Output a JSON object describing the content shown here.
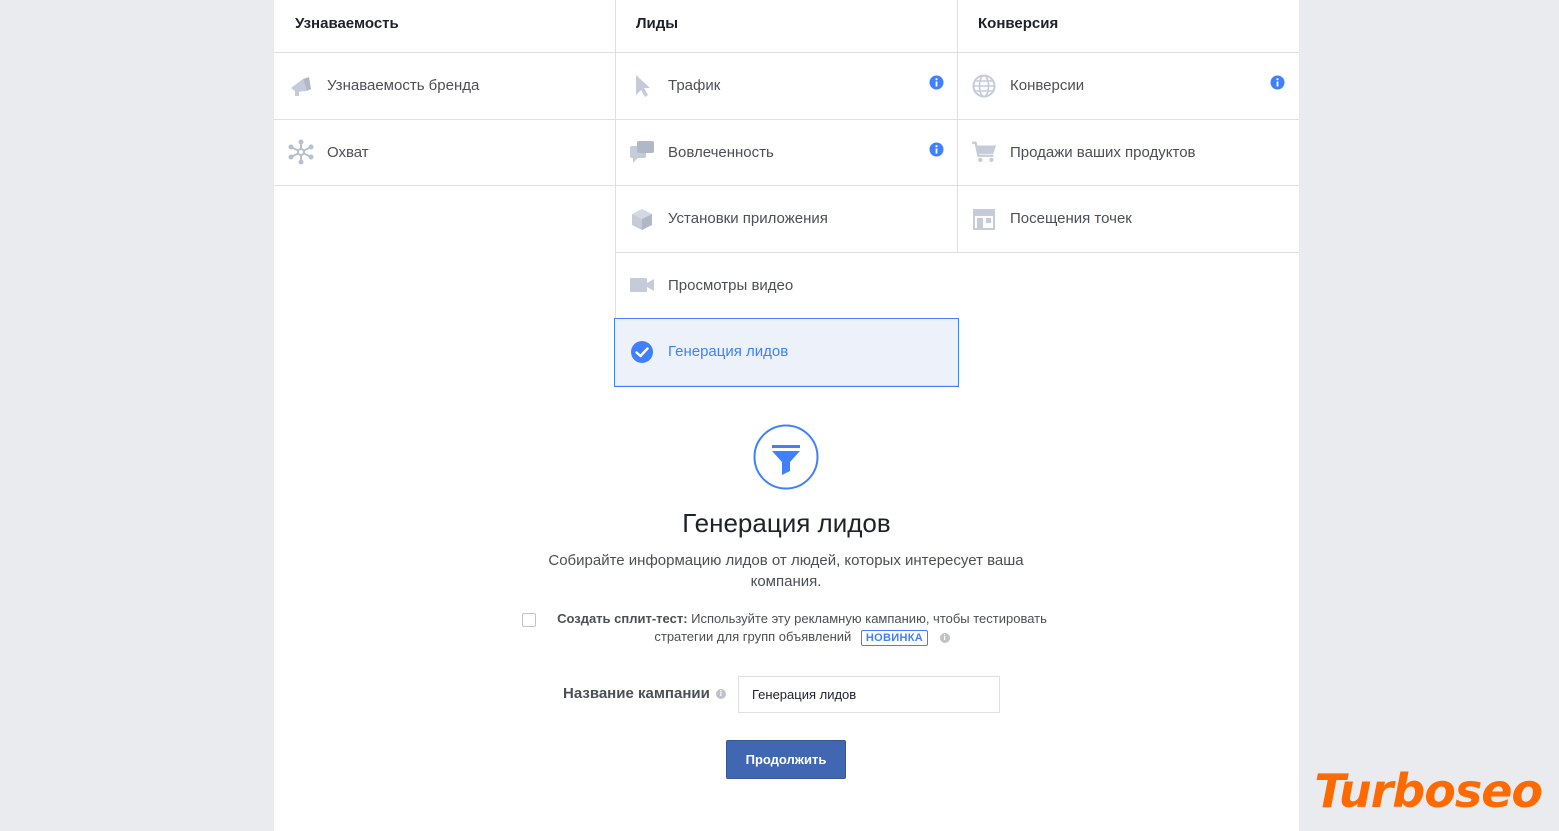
{
  "colors": {
    "accent": "#4080ff",
    "button": "#4267b2",
    "selected_bg": "#edf2fa",
    "watermark": "#ff6a00"
  },
  "columns": [
    {
      "title": "Узнаваемость",
      "items": [
        {
          "label": "Узнаваемость бренда",
          "icon": "megaphone-icon",
          "info": false
        },
        {
          "label": "Охват",
          "icon": "reach-icon",
          "info": false
        }
      ]
    },
    {
      "title": "Лиды",
      "items": [
        {
          "label": "Трафик",
          "icon": "cursor-icon",
          "info": true
        },
        {
          "label": "Вовлеченность",
          "icon": "chat-bubbles-icon",
          "info": true
        },
        {
          "label": "Установки приложения",
          "icon": "box-icon",
          "info": false
        },
        {
          "label": "Просмотры видео",
          "icon": "video-camera-icon",
          "info": false
        },
        {
          "label": "Генерация лидов",
          "icon": "check-circle-icon",
          "info": false,
          "selected": true
        }
      ]
    },
    {
      "title": "Конверсия",
      "items": [
        {
          "label": "Конверсии",
          "icon": "globe-icon",
          "info": true
        },
        {
          "label": "Продажи ваших продуктов",
          "icon": "cart-icon",
          "info": false
        },
        {
          "label": "Посещения точек",
          "icon": "store-icon",
          "info": false
        }
      ]
    }
  ],
  "detail": {
    "icon": "funnel-icon",
    "title": "Генерация лидов",
    "description": "Собирайте информацию лидов от людей, которых интересует ваша компания."
  },
  "split_test": {
    "checked": false,
    "label": "Создать сплит-тест:",
    "text": "Используйте эту рекламную кампанию, чтобы тестировать стратегии для групп объявлений",
    "badge": "НОВИНКА"
  },
  "campaign": {
    "label": "Название кампании",
    "value": "Генерация лидов"
  },
  "continue_label": "Продолжить",
  "watermark": "Turboseo"
}
